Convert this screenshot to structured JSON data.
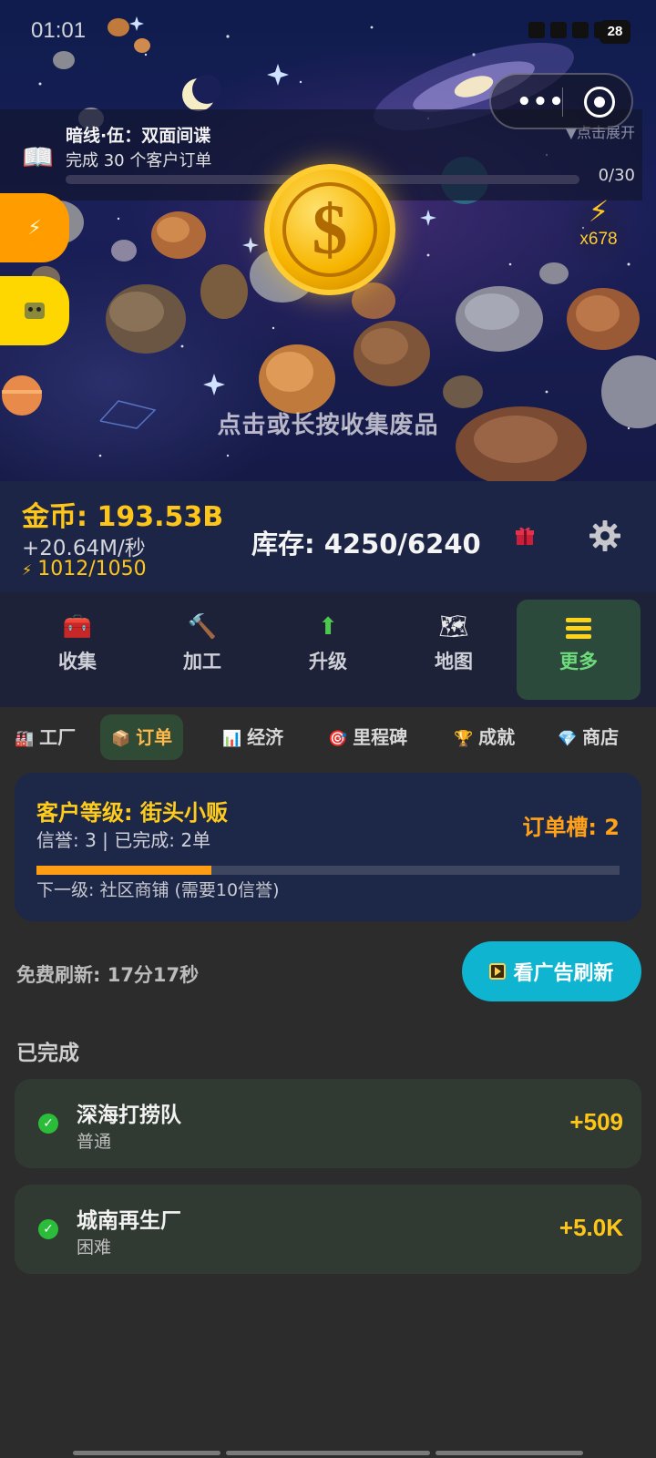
{
  "status_bar": {
    "time": "01:01",
    "battery": "28"
  },
  "quest": {
    "title": "暗线·伍：双面间谍",
    "description": "完成 30 个客户订单",
    "expand_hint": "▼点击展开",
    "progress_text": "0/30",
    "progress": 0
  },
  "boost": {
    "label": "x678"
  },
  "scene": {
    "hint": "点击或长按收集废品"
  },
  "stats": {
    "gold": "金币: 193.53B",
    "rate": "+20.64M/秒",
    "energy": "1012/1050",
    "stock": "库存: 4250/6240"
  },
  "main_nav": [
    {
      "label": "收集",
      "icon": "toolbox-icon"
    },
    {
      "label": "加工",
      "icon": "hammer-icon"
    },
    {
      "label": "升级",
      "icon": "arrow-up-icon"
    },
    {
      "label": "地图",
      "icon": "map-icon"
    },
    {
      "label": "更多",
      "icon": "menu-icon"
    }
  ],
  "sub_tabs": [
    {
      "label": "工厂",
      "icon": "factory-icon"
    },
    {
      "label": "订单",
      "icon": "box-icon"
    },
    {
      "label": "经济",
      "icon": "bar-chart-icon"
    },
    {
      "label": "里程碑",
      "icon": "target-icon"
    },
    {
      "label": "成就",
      "icon": "trophy-icon"
    },
    {
      "label": "商店",
      "icon": "diamond-icon"
    }
  ],
  "customer": {
    "level": "客户等级: 街头小贩",
    "summary": "信誉: 3 | 已完成: 2单",
    "slots": "订单槽: 2",
    "next_level": "下一级: 社区商铺 (需要10信誉)",
    "progress": 0.3
  },
  "refresh": {
    "timer": "免费刷新: 17分17秒",
    "ad_button": "看广告刷新"
  },
  "completed": {
    "title": "已完成",
    "orders": [
      {
        "name": "深海打捞队",
        "difficulty": "普通",
        "reward": "+509"
      },
      {
        "name": "城南再生厂",
        "difficulty": "困难",
        "reward": "+5.0K"
      }
    ]
  },
  "colors": {
    "gold": "#ffc61a",
    "accent_green": "#6edc7c",
    "order_tab": "#ffb94a",
    "ad_button": "#0fb4d0"
  }
}
